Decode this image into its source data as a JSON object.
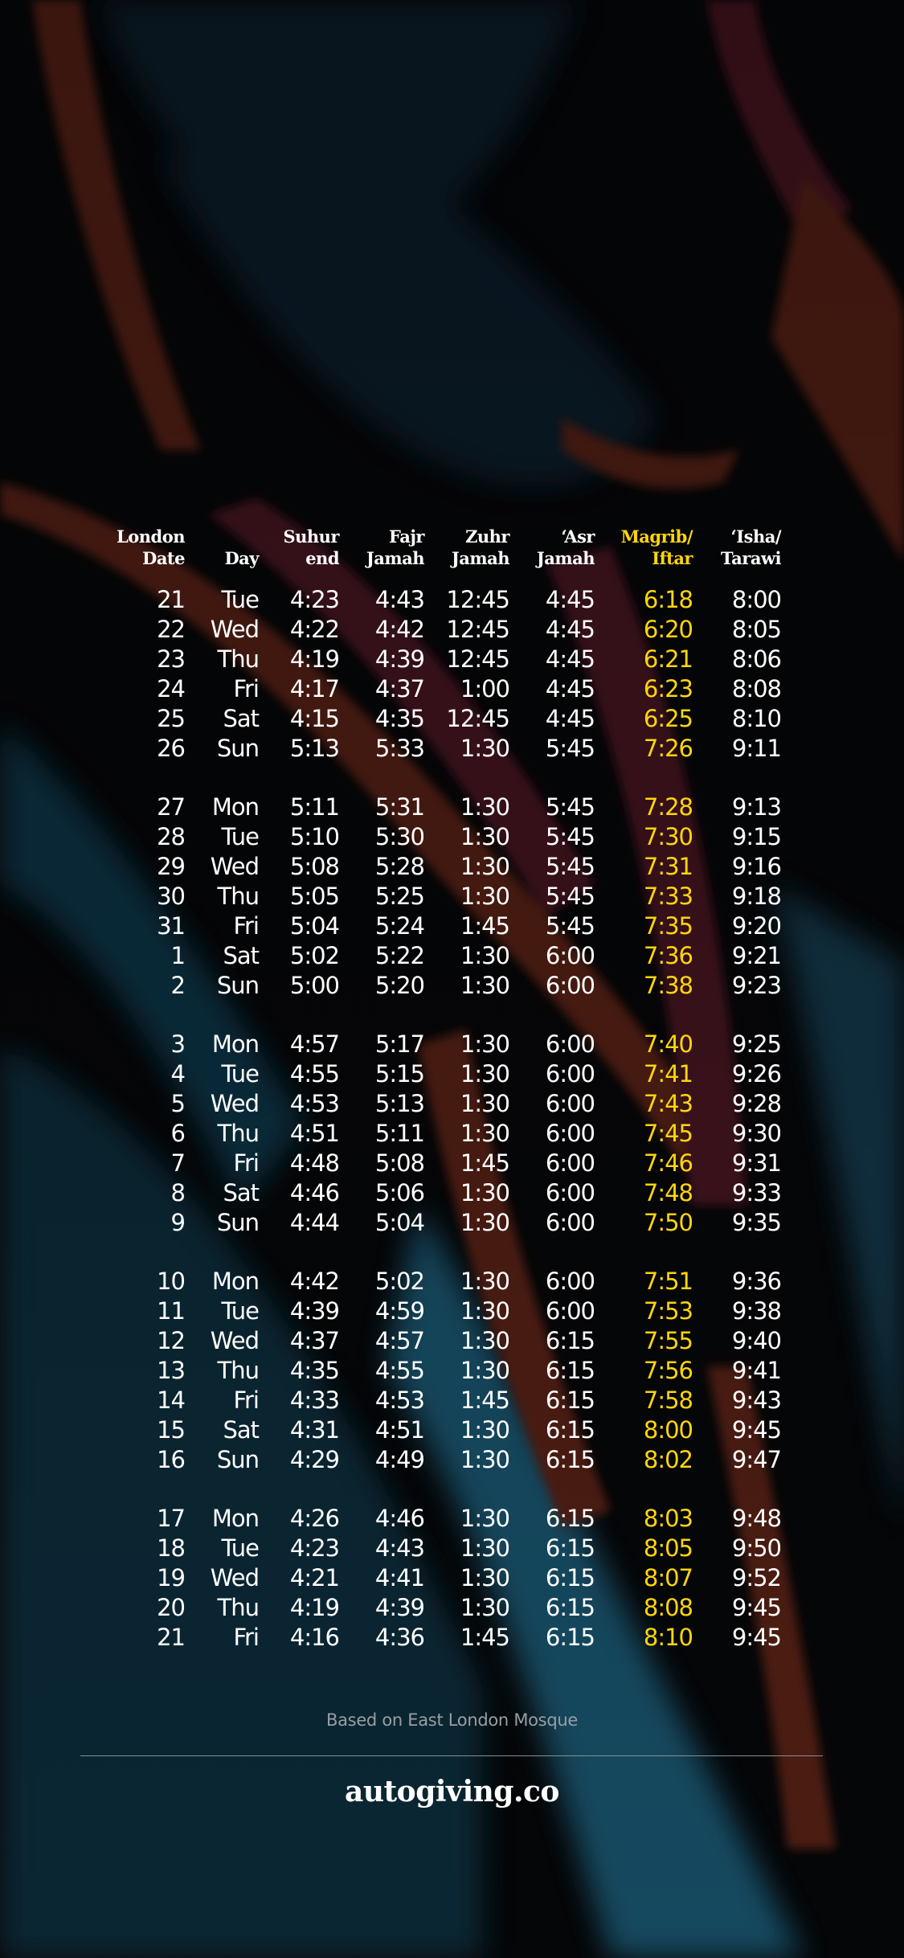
{
  "colors": {
    "highlight": "#FFD60A",
    "text": "#FFFFFF",
    "muted": "#9A9EA3"
  },
  "header": {
    "columns": [
      {
        "line1": "London",
        "line2": "Date",
        "highlight": false
      },
      {
        "line1": "",
        "line2": "Day",
        "highlight": false
      },
      {
        "line1": "Suhur",
        "line2": "end",
        "highlight": false
      },
      {
        "line1": "Fajr",
        "line2": "Jamah",
        "highlight": false
      },
      {
        "line1": "Zuhr",
        "line2": "Jamah",
        "highlight": false
      },
      {
        "line1": "‘Asr",
        "line2": "Jamah",
        "highlight": false
      },
      {
        "line1": "Magrib/",
        "line2": "Iftar",
        "highlight": true
      },
      {
        "line1": "‘Isha/",
        "line2": "Tarawi",
        "highlight": false
      }
    ]
  },
  "weeks": [
    [
      [
        "21",
        "Tue",
        "4:23",
        "4:43",
        "12:45",
        "4:45",
        "6:18",
        "8:00"
      ],
      [
        "22",
        "Wed",
        "4:22",
        "4:42",
        "12:45",
        "4:45",
        "6:20",
        "8:05"
      ],
      [
        "23",
        "Thu",
        "4:19",
        "4:39",
        "12:45",
        "4:45",
        "6:21",
        "8:06"
      ],
      [
        "24",
        "Fri",
        "4:17",
        "4:37",
        "1:00",
        "4:45",
        "6:23",
        "8:08"
      ],
      [
        "25",
        "Sat",
        "4:15",
        "4:35",
        "12:45",
        "4:45",
        "6:25",
        "8:10"
      ],
      [
        "26",
        "Sun",
        "5:13",
        "5:33",
        "1:30",
        "5:45",
        "7:26",
        "9:11"
      ]
    ],
    [
      [
        "27",
        "Mon",
        "5:11",
        "5:31",
        "1:30",
        "5:45",
        "7:28",
        "9:13"
      ],
      [
        "28",
        "Tue",
        "5:10",
        "5:30",
        "1:30",
        "5:45",
        "7:30",
        "9:15"
      ],
      [
        "29",
        "Wed",
        "5:08",
        "5:28",
        "1:30",
        "5:45",
        "7:31",
        "9:16"
      ],
      [
        "30",
        "Thu",
        "5:05",
        "5:25",
        "1:30",
        "5:45",
        "7:33",
        "9:18"
      ],
      [
        "31",
        "Fri",
        "5:04",
        "5:24",
        "1:45",
        "5:45",
        "7:35",
        "9:20"
      ],
      [
        "1",
        "Sat",
        "5:02",
        "5:22",
        "1:30",
        "6:00",
        "7:36",
        "9:21"
      ],
      [
        "2",
        "Sun",
        "5:00",
        "5:20",
        "1:30",
        "6:00",
        "7:38",
        "9:23"
      ]
    ],
    [
      [
        "3",
        "Mon",
        "4:57",
        "5:17",
        "1:30",
        "6:00",
        "7:40",
        "9:25"
      ],
      [
        "4",
        "Tue",
        "4:55",
        "5:15",
        "1:30",
        "6:00",
        "7:41",
        "9:26"
      ],
      [
        "5",
        "Wed",
        "4:53",
        "5:13",
        "1:30",
        "6:00",
        "7:43",
        "9:28"
      ],
      [
        "6",
        "Thu",
        "4:51",
        "5:11",
        "1:30",
        "6:00",
        "7:45",
        "9:30"
      ],
      [
        "7",
        "Fri",
        "4:48",
        "5:08",
        "1:45",
        "6:00",
        "7:46",
        "9:31"
      ],
      [
        "8",
        "Sat",
        "4:46",
        "5:06",
        "1:30",
        "6:00",
        "7:48",
        "9:33"
      ],
      [
        "9",
        "Sun",
        "4:44",
        "5:04",
        "1:30",
        "6:00",
        "7:50",
        "9:35"
      ]
    ],
    [
      [
        "10",
        "Mon",
        "4:42",
        "5:02",
        "1:30",
        "6:00",
        "7:51",
        "9:36"
      ],
      [
        "11",
        "Tue",
        "4:39",
        "4:59",
        "1:30",
        "6:00",
        "7:53",
        "9:38"
      ],
      [
        "12",
        "Wed",
        "4:37",
        "4:57",
        "1:30",
        "6:15",
        "7:55",
        "9:40"
      ],
      [
        "13",
        "Thu",
        "4:35",
        "4:55",
        "1:30",
        "6:15",
        "7:56",
        "9:41"
      ],
      [
        "14",
        "Fri",
        "4:33",
        "4:53",
        "1:45",
        "6:15",
        "7:58",
        "9:43"
      ],
      [
        "15",
        "Sat",
        "4:31",
        "4:51",
        "1:30",
        "6:15",
        "8:00",
        "9:45"
      ],
      [
        "16",
        "Sun",
        "4:29",
        "4:49",
        "1:30",
        "6:15",
        "8:02",
        "9:47"
      ]
    ],
    [
      [
        "17",
        "Mon",
        "4:26",
        "4:46",
        "1:30",
        "6:15",
        "8:03",
        "9:48"
      ],
      [
        "18",
        "Tue",
        "4:23",
        "4:43",
        "1:30",
        "6:15",
        "8:05",
        "9:50"
      ],
      [
        "19",
        "Wed",
        "4:21",
        "4:41",
        "1:30",
        "6:15",
        "8:07",
        "9:52"
      ],
      [
        "20",
        "Thu",
        "4:19",
        "4:39",
        "1:30",
        "6:15",
        "8:08",
        "9:45"
      ],
      [
        "21",
        "Fri",
        "4:16",
        "4:36",
        "1:45",
        "6:15",
        "8:10",
        "9:45"
      ]
    ]
  ],
  "footer": {
    "note": "Based on East London Mosque",
    "brand": "autogiving.co"
  }
}
